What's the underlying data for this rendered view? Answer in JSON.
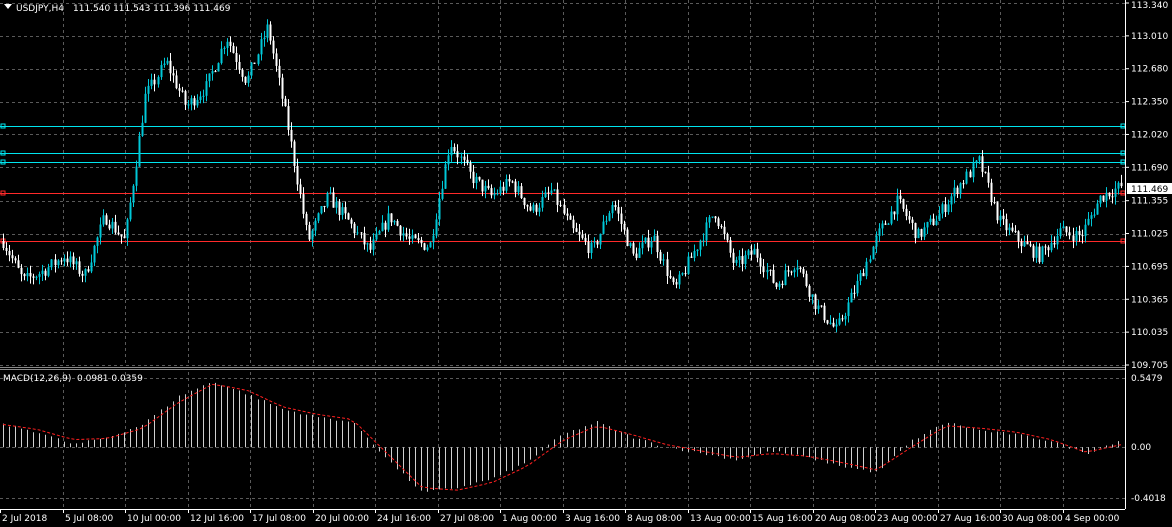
{
  "header": {
    "symbol_label": "USDJPY,H4",
    "ohlc": "111.540 111.543 111.396 111.469"
  },
  "macd_header": {
    "label": "MACD(12,26,9)",
    "values": "0.0981 0.0359"
  },
  "colors": {
    "background": "#000000",
    "grid": "#5a5a5a",
    "bull_candle": "#00c8d8",
    "bear_candle": "#ffffff",
    "macd_hist": "#d0d0d0",
    "macd_signal": "#ff2020",
    "cyan_line": "#00e5ee",
    "red_line": "#ff2a2a",
    "price_tag_bg": "#ffffff",
    "price_tag_fg": "#000000"
  },
  "price_axis": {
    "ticks": [
      "113.340",
      "113.010",
      "112.680",
      "112.350",
      "112.020",
      "111.690",
      "111.355",
      "111.025",
      "110.695",
      "110.365",
      "110.035",
      "109.705"
    ],
    "current_price": "111.469"
  },
  "macd_axis": {
    "ticks": [
      "0.5479",
      "0.00",
      "-0.4018"
    ]
  },
  "time_axis": {
    "labels": [
      "2 Jul 2018",
      "5 Jul 08:00",
      "10 Jul 00:00",
      "12 Jul 16:00",
      "17 Jul 08:00",
      "20 Jul 00:00",
      "24 Jul 16:00",
      "27 Jul 08:00",
      "1 Aug 00:00",
      "3 Aug 16:00",
      "8 Aug 08:00",
      "13 Aug 00:00",
      "15 Aug 16:00",
      "20 Aug 08:00",
      "23 Aug 00:00",
      "27 Aug 16:00",
      "30 Aug 08:00",
      "4 Sep 00:00"
    ]
  },
  "horizontal_lines": [
    {
      "price": 112.1,
      "color": "cyan"
    },
    {
      "price": 111.83,
      "color": "cyan"
    },
    {
      "price": 111.74,
      "color": "cyan"
    },
    {
      "price": 111.43,
      "color": "red"
    },
    {
      "price": 110.95,
      "color": "red"
    }
  ],
  "chart_data": {
    "type": "candlestick",
    "symbol": "USDJPY",
    "timeframe": "H4",
    "ylim": [
      109.705,
      113.34
    ],
    "close_path": [
      110.95,
      110.55,
      110.65,
      110.8,
      110.6,
      111.2,
      110.95,
      112.4,
      112.75,
      112.3,
      112.5,
      113.0,
      112.55,
      113.1,
      112.1,
      110.95,
      111.4,
      111.15,
      110.85,
      111.2,
      110.95,
      110.9,
      111.95,
      111.6,
      111.4,
      111.55,
      111.25,
      111.45,
      111.05,
      110.85,
      111.35,
      110.8,
      111.0,
      110.45,
      110.85,
      111.25,
      110.7,
      110.85,
      110.5,
      110.75,
      110.3,
      110.05,
      110.5,
      111.0,
      111.35,
      111.0,
      111.2,
      111.5,
      111.75,
      111.15,
      110.95,
      110.8,
      111.05,
      111.0,
      111.4,
      111.5
    ]
  },
  "macd_data": {
    "type": "histogram+line",
    "ylim": [
      -0.4018,
      0.5479
    ],
    "hist_path": [
      0.18,
      0.12,
      0.02,
      0.08,
      0.18,
      0.4,
      0.52,
      0.42,
      0.3,
      0.24,
      0.2,
      -0.1,
      -0.36,
      -0.32,
      -0.25,
      -0.12,
      0.1,
      0.2,
      0.08,
      0.0,
      -0.05,
      -0.1,
      -0.03,
      -0.08,
      -0.15,
      -0.2,
      0.05,
      0.2,
      0.13,
      0.1,
      0.05,
      -0.05,
      0.06
    ],
    "signal_path": [
      0.18,
      0.14,
      0.06,
      0.07,
      0.15,
      0.35,
      0.5,
      0.45,
      0.32,
      0.26,
      0.22,
      -0.05,
      -0.32,
      -0.34,
      -0.28,
      -0.15,
      0.05,
      0.17,
      0.1,
      0.02,
      -0.03,
      -0.08,
      -0.05,
      -0.07,
      -0.12,
      -0.18,
      0.0,
      0.17,
      0.15,
      0.12,
      0.06,
      -0.04,
      0.02
    ]
  }
}
